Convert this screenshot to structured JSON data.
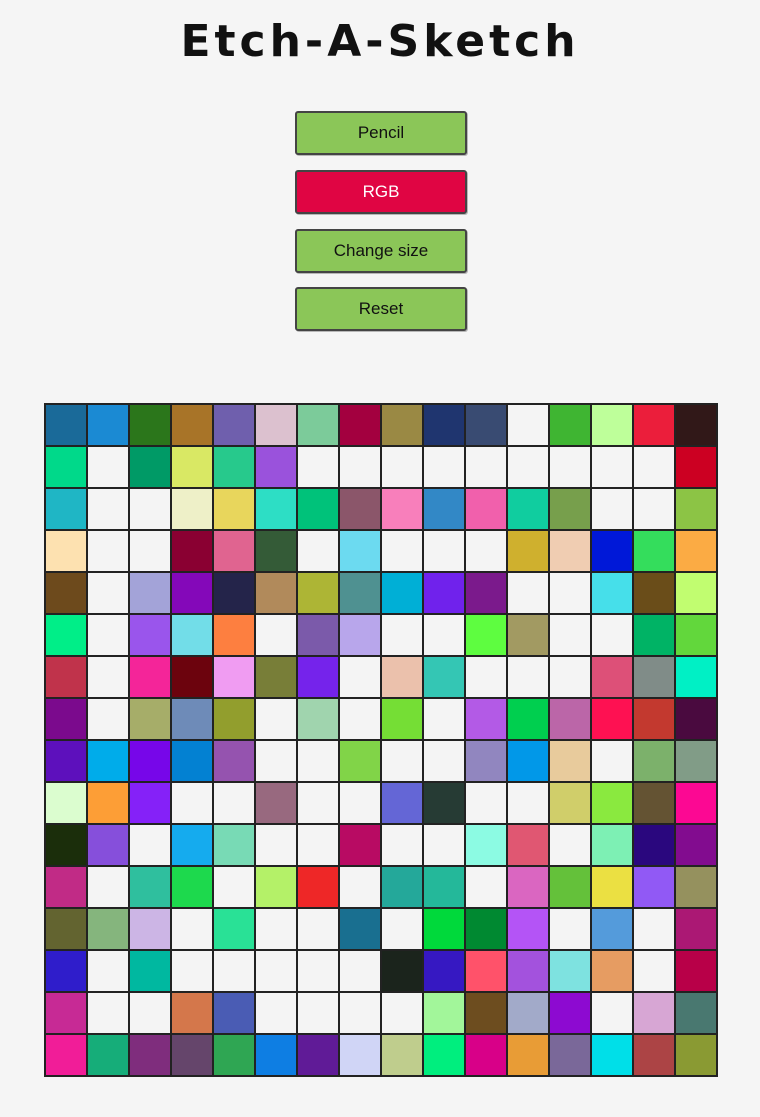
{
  "app": {
    "title": "Etch-A-Sketch"
  },
  "controls": {
    "pencil_label": "Pencil",
    "rgb_label": "RGB",
    "change_size_label": "Change size",
    "reset_label": "Reset",
    "active_mode": "RGB"
  },
  "colors": {
    "button_default": "#8bc658",
    "button_active": "#e00543",
    "button_text_default": "#111111",
    "button_text_active": "#ffffff",
    "empty_cell": "#f4f4f4",
    "grid_line": "#222222"
  },
  "grid": {
    "size": 16,
    "cells": [
      [
        "#1a6a99",
        "#1b8ad3",
        "#2b761b",
        "#a87428",
        "#6f5fad",
        "#dcc1cf",
        "#7ccb9a",
        "#a3003f",
        "#9a8944",
        "#1f356f",
        "#394b72",
        "#f4f4f4",
        "#3fb532",
        "#beff9a",
        "#eb1e3b",
        "#311818"
      ],
      [
        "#00d98a",
        "#f4f4f4",
        "#009a66",
        "#d9e864",
        "#27c98c",
        "#9a52dc",
        "#f4f4f4",
        "#f4f4f4",
        "#f4f4f4",
        "#f4f4f4",
        "#f4f4f4",
        "#f4f4f4",
        "#f4f4f4",
        "#f4f4f4",
        "#f4f4f4",
        "#cc0022"
      ],
      [
        "#1fb6c5",
        "#f4f4f4",
        "#f4f4f4",
        "#eef0c8",
        "#e8d65c",
        "#2ddec5",
        "#00c27a",
        "#8b566a",
        "#f87fbb",
        "#3288c6",
        "#f160ac",
        "#10cd9f",
        "#779f4c",
        "#f4f4f4",
        "#f4f4f4",
        "#8cc445"
      ],
      [
        "#fde1b0",
        "#f4f4f4",
        "#f4f4f4",
        "#8a0032",
        "#e06490",
        "#345b37",
        "#f4f4f4",
        "#6cdaf0",
        "#f4f4f4",
        "#f4f4f4",
        "#f4f4f4",
        "#cfb02e",
        "#f0cdb2",
        "#0018d8",
        "#34dd5c",
        "#fbab44"
      ],
      [
        "#6d4a1c",
        "#f4f4f4",
        "#a3a3d8",
        "#8408b9",
        "#24244a",
        "#b18a5b",
        "#adb535",
        "#4f9191",
        "#00afd6",
        "#7022ec",
        "#7b1a8c",
        "#f4f4f4",
        "#f4f4f4",
        "#46dfea",
        "#6a4d19",
        "#c1fd70"
      ],
      [
        "#00ee88",
        "#f4f4f4",
        "#9a55ec",
        "#72dde8",
        "#fd7f40",
        "#f4f4f4",
        "#7b5aaa",
        "#b8a6eb",
        "#f4f4f4",
        "#f4f4f4",
        "#5efd40",
        "#a29a62",
        "#f4f4f4",
        "#f4f4f4",
        "#00b365",
        "#62d73c"
      ],
      [
        "#c0334b",
        "#f4f4f4",
        "#f42599",
        "#6c030d",
        "#f09cf2",
        "#787e38",
        "#7523eb",
        "#f4f4f4",
        "#ebc1ac",
        "#34c6b4",
        "#f4f4f4",
        "#f4f4f4",
        "#f4f4f4",
        "#dd5078",
        "#808c88",
        "#00f0c5"
      ],
      [
        "#7b0a8d",
        "#f4f4f4",
        "#a6ad69",
        "#6e8bb8",
        "#929e2d",
        "#f4f4f4",
        "#a0d4ae",
        "#f4f4f4",
        "#75de35",
        "#f4f4f4",
        "#b35ae6",
        "#00cf4f",
        "#bb66a8",
        "#fe1152",
        "#c3392f",
        "#4a0a3f"
      ],
      [
        "#5d10bc",
        "#00acea",
        "#7706e9",
        "#0381d2",
        "#9553af",
        "#f4f4f4",
        "#f4f4f4",
        "#81d448",
        "#f4f4f4",
        "#f4f4f4",
        "#9186bf",
        "#0198e8",
        "#e8cb9c",
        "#f4f4f4",
        "#7cb16b",
        "#819c87"
      ],
      [
        "#dbfdcf",
        "#fd9e36",
        "#8521f8",
        "#f4f4f4",
        "#f4f4f4",
        "#98697f",
        "#f4f4f4",
        "#f4f4f4",
        "#6466d6",
        "#263b34",
        "#f4f4f4",
        "#f4f4f4",
        "#d0ce6a",
        "#8ae93f",
        "#645333",
        "#fc0893"
      ],
      [
        "#1b2e0b",
        "#864fdb",
        "#f4f4f4",
        "#15abee",
        "#78dab5",
        "#f4f4f4",
        "#f4f4f4",
        "#b80b63",
        "#f4f4f4",
        "#f4f4f4",
        "#8cfbe3",
        "#e05772",
        "#f4f4f4",
        "#7df0b4",
        "#2a077e",
        "#820c8f"
      ],
      [
        "#c12b86",
        "#f4f4f4",
        "#2fbf9e",
        "#1dd94d",
        "#f4f4f4",
        "#b4f168",
        "#ee2727",
        "#f4f4f4",
        "#24a89a",
        "#24b89a",
        "#f4f4f4",
        "#da66c1",
        "#64c13a",
        "#ebe042",
        "#9159f5",
        "#95915e"
      ],
      [
        "#636430",
        "#85b57d",
        "#ccb5e5",
        "#f4f4f4",
        "#29e196",
        "#f4f4f4",
        "#f4f4f4",
        "#196f90",
        "#f4f4f4",
        "#00d93b",
        "#008931",
        "#b454f6",
        "#f4f4f4",
        "#549bdb",
        "#f4f4f4",
        "#ab1874"
      ],
      [
        "#2f1dcb",
        "#f4f4f4",
        "#00b8a0",
        "#f4f4f4",
        "#f4f4f4",
        "#f4f4f4",
        "#f4f4f4",
        "#f4f4f4",
        "#1b241c",
        "#3618c2",
        "#ff526a",
        "#a352dd",
        "#7ee2e0",
        "#e69c62",
        "#f4f4f4",
        "#b80048"
      ],
      [
        "#c72a95",
        "#f4f4f4",
        "#f4f4f4",
        "#d4774b",
        "#4a5cb4",
        "#f4f4f4",
        "#f4f4f4",
        "#f4f4f4",
        "#f4f4f4",
        "#a2f69a",
        "#6d4d1f",
        "#a2aac9",
        "#8d0ad1",
        "#f4f4f4",
        "#d7a6d4",
        "#497870"
      ],
      [
        "#f11d98",
        "#16ad79",
        "#7f2d7d",
        "#65456b",
        "#2fa653",
        "#0e7ee3",
        "#601b97",
        "#d0d5f6",
        "#bfcd8d",
        "#00ee7e",
        "#d80088",
        "#e89c36",
        "#7a6899",
        "#00dfe8",
        "#ac4445",
        "#8a9a33"
      ]
    ]
  }
}
